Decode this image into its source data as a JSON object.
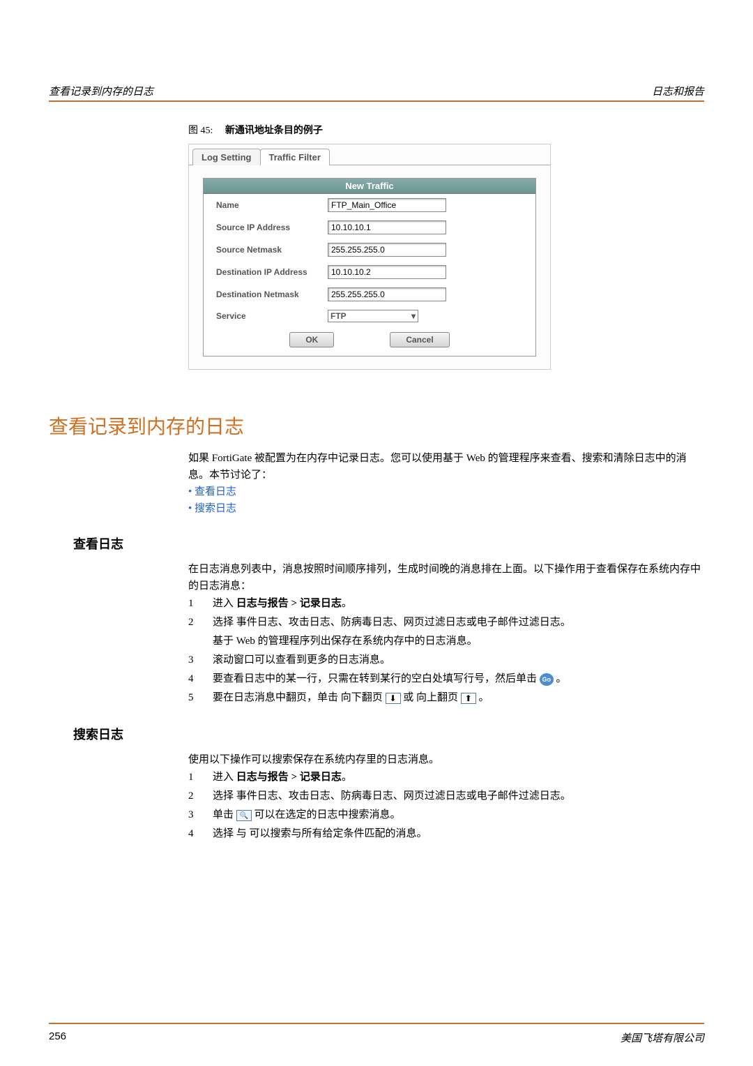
{
  "header": {
    "left": "查看记录到内存的日志",
    "right": "日志和报告"
  },
  "figure": {
    "label_prefix": "图 45:",
    "caption": "新通讯地址条目的例子",
    "tabs": {
      "log_setting": "Log Setting",
      "traffic_filter": "Traffic Filter"
    },
    "panel_title": "New Traffic",
    "fields": {
      "name_label": "Name",
      "name_value": "FTP_Main_Office",
      "src_ip_label": "Source IP Address",
      "src_ip_value": "10.10.10.1",
      "src_nm_label": "Source Netmask",
      "src_nm_value": "255.255.255.0",
      "dst_ip_label": "Destination IP Address",
      "dst_ip_value": "10.10.10.2",
      "dst_nm_label": "Destination Netmask",
      "dst_nm_value": "255.255.255.0",
      "service_label": "Service",
      "service_value": "FTP"
    },
    "buttons": {
      "ok": "OK",
      "cancel": "Cancel"
    }
  },
  "section1": {
    "title": "查看记录到内存的日志",
    "intro": "如果 FortiGate 被配置为在内存中记录日志。您可以使用基于 Web 的管理程序来查看、搜索和清除日志中的消息。本节讨论了：",
    "bullets": {
      "b1": "查看日志",
      "b2": "搜索日志"
    }
  },
  "sub1": {
    "title": "查看日志",
    "intro": "在日志消息列表中，消息按照时间顺序排列，生成时间晚的消息排在上面。以下操作用于查看保存在系统内存中的日志消息：",
    "steps": {
      "s1a": "进入",
      "s1b": "日志与报告 > 记录日志",
      "s1c": "。",
      "s2a": "选择 事件日志、攻击日志、防病毒日志、网页过滤日志或电子邮件过滤日志。",
      "s2b": "基于 Web 的管理程序列出保存在系统内存中的日志消息。",
      "s3": "滚动窗口可以查看到更多的日志消息。",
      "s4a": "要查看日志中的某一行，只需在转到某行的空白处填写行号，然后单击 ",
      "s4b": "Go",
      "s4c": "。",
      "s5a": "要在日志消息中翻页，单击 向下翻页 ",
      "s5b": " 或 向上翻页 ",
      "s5c": "。"
    }
  },
  "sub2": {
    "title": "搜索日志",
    "intro": "使用以下操作可以搜索保存在系统内存里的日志消息。",
    "steps": {
      "s1a": "进入 ",
      "s1b": "日志与报告 > 记录日志",
      "s1c": "。",
      "s2": "选择 事件日志、攻击日志、防病毒日志、网页过滤日志或电子邮件过滤日志。",
      "s3a": "单击 ",
      "s3b": "可以在选定的日志中搜索消息。",
      "s4": "选择 与 可以搜索与所有给定条件匹配的消息。"
    }
  },
  "footer": {
    "page": "256",
    "company": "美国飞塔有限公司"
  }
}
